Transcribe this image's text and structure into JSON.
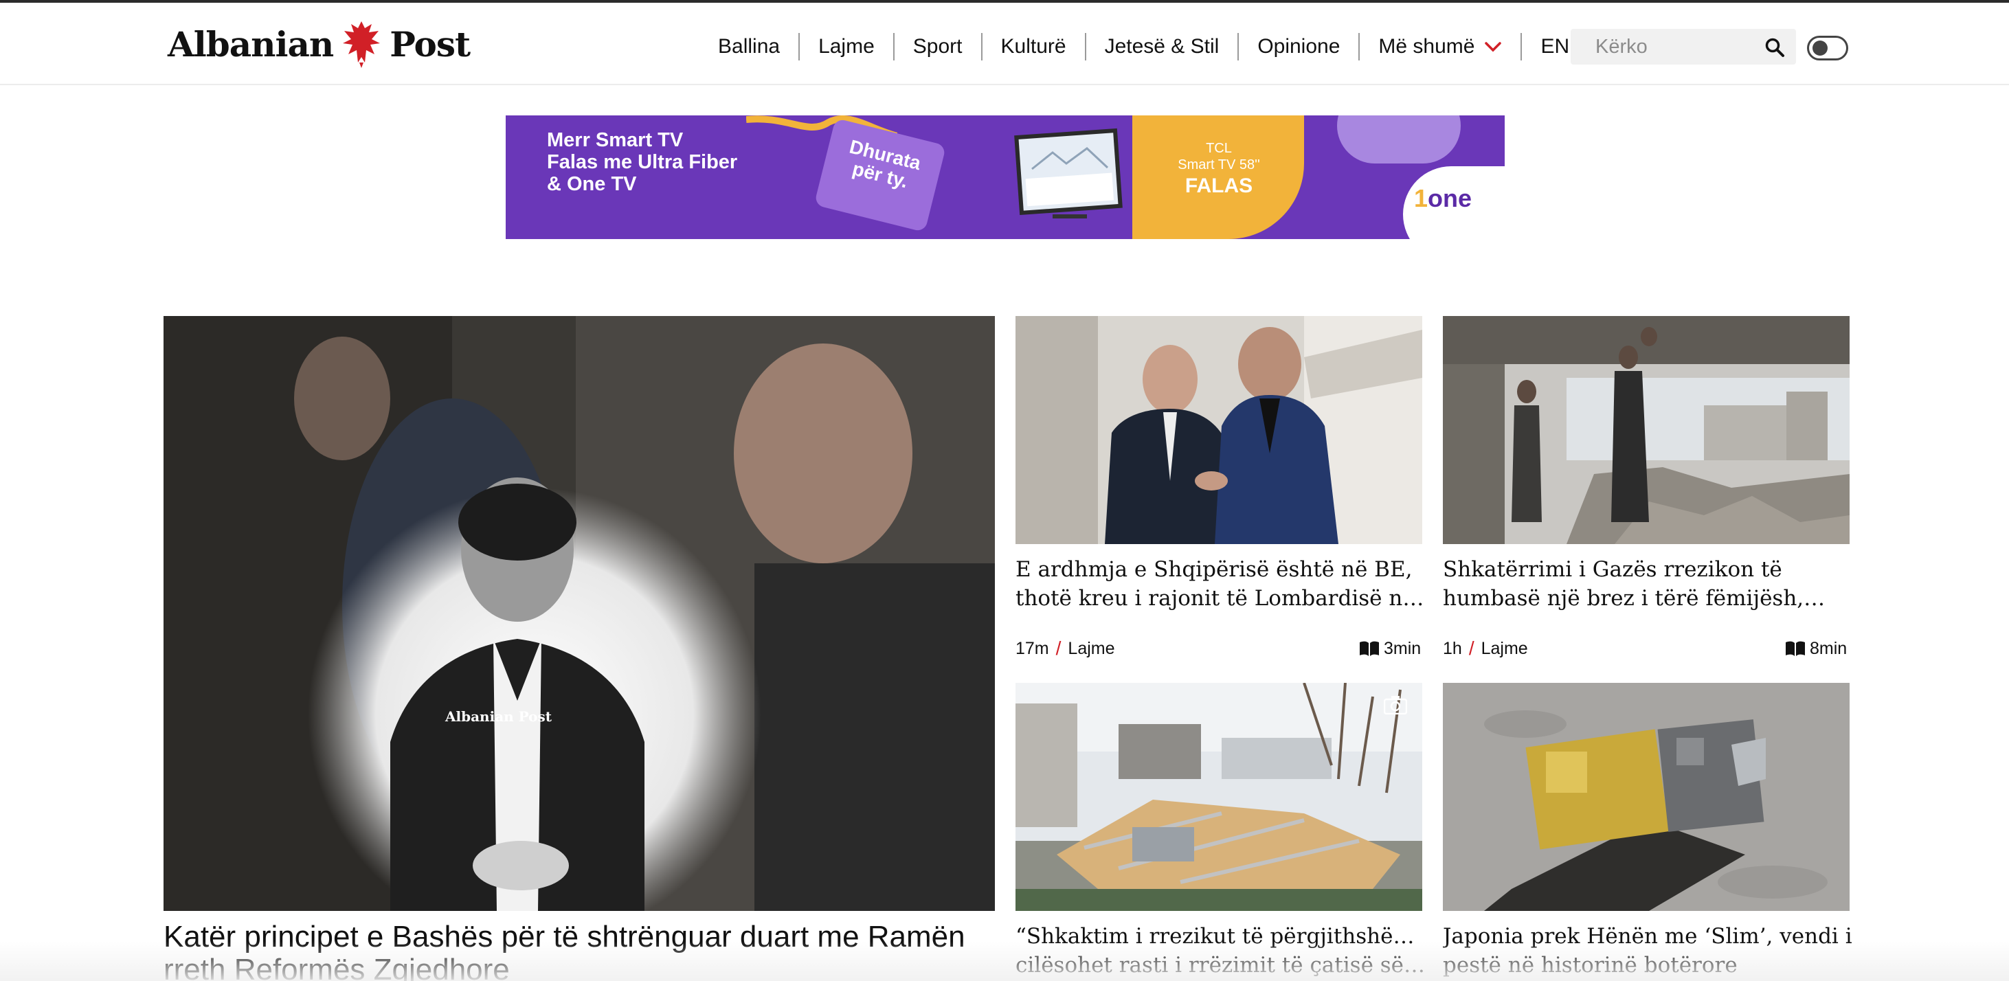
{
  "site": {
    "logo_left": "Albanian",
    "logo_right": "Post"
  },
  "nav": {
    "items": [
      {
        "label": "Ballina"
      },
      {
        "label": "Lajme"
      },
      {
        "label": "Sport"
      },
      {
        "label": "Kulturë"
      },
      {
        "label": "Jetesë & Stil"
      },
      {
        "label": "Opinione"
      },
      {
        "label": "Më shumë"
      },
      {
        "label": "EN"
      }
    ]
  },
  "search": {
    "placeholder": "Kërko"
  },
  "banner": {
    "line1": "Merr Smart TV",
    "line2": "Falas me Ultra Fiber",
    "line3": "& One TV",
    "tag_line1": "Dhurata",
    "tag_line2": "për ty.",
    "tv_brand": "TCL",
    "tv_model": "Smart TV 58''",
    "tv_offer": "FALAS",
    "brand": "one",
    "brand_number": "1"
  },
  "hero": {
    "title_line1": "Katër principet e Bashës për të shtrënguar duart me Ramën",
    "title_line2": "rreth Reformës Zgjedhore"
  },
  "cards": [
    {
      "title_line1": "E ardhmja e Shqipërisë është në BE,",
      "title_line2": "thotë kreu i rajonit të Lombardisë në…",
      "time": "17m",
      "category": "Lajme",
      "read_time": "3min"
    },
    {
      "title_line1": "Shkatërrimi i Gazës rrezikon të",
      "title_line2": "humbasë një brez i tërë fëmijësh,…",
      "time": "1h",
      "category": "Lajme",
      "read_time": "8min"
    },
    {
      "title_line1": "“Shkaktim i rrezikut të përgjithshëm”,",
      "title_line2": "cilësohet rasti i rrëzimit të çatisë së…"
    },
    {
      "title_line1": "Japonia prek Hënën me ‘Slim’, vendi i",
      "title_line2": "pestë në historinë botërore"
    }
  ],
  "colors": {
    "accent": "#d12027",
    "banner_purple": "#6a37b8",
    "banner_yellow": "#f2b33a"
  }
}
